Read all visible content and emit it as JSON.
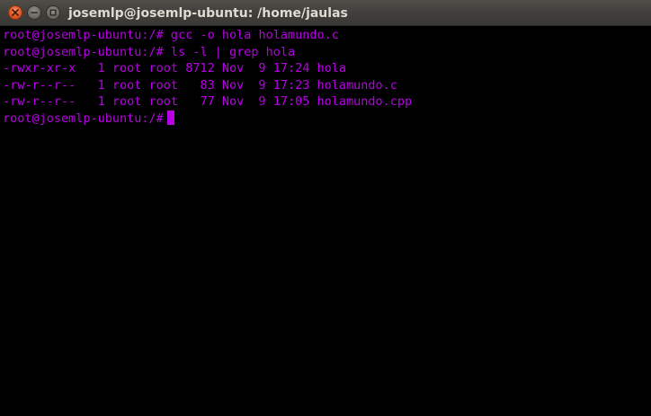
{
  "window": {
    "title": "josemlp@josemlp-ubuntu: /home/jaulas",
    "buttons": {
      "close": "close-icon",
      "minimize": "minimize-icon",
      "maximize": "maximize-icon"
    }
  },
  "terminal": {
    "text_color": "#b800e6",
    "background_color": "#000000",
    "lines": [
      "root@josemlp-ubuntu:/# gcc -o hola holamundo.c",
      "root@josemlp-ubuntu:/# ls -l | grep hola",
      "-rwxr-xr-x   1 root root 8712 Nov  9 17:24 hola",
      "-rw-r--r--   1 root root   83 Nov  9 17:23 holamundo.c",
      "-rw-r--r--   1 root root   77 Nov  9 17:05 holamundo.cpp"
    ],
    "prompt": "root@josemlp-ubuntu:/#"
  }
}
